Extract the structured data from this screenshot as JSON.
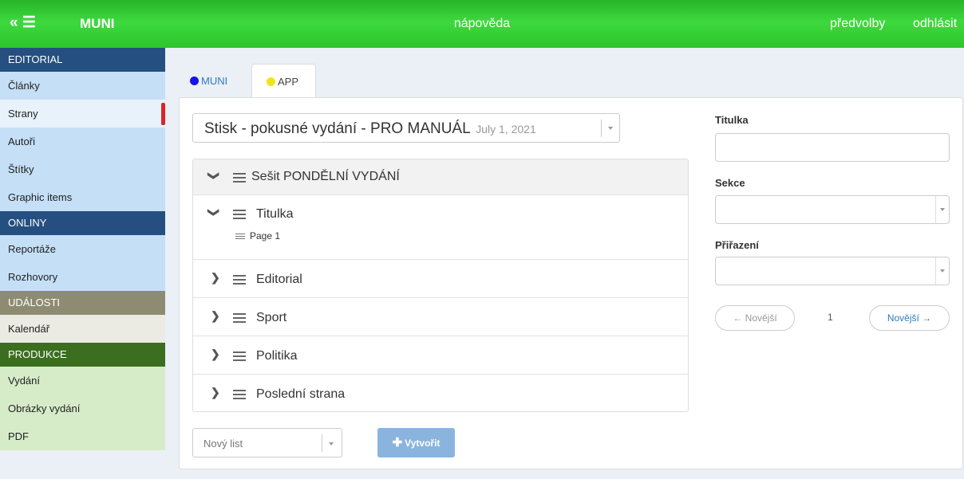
{
  "topbar": {
    "menu_toggle": "« ☰",
    "brand": "MUNI",
    "help": "nápověda",
    "preferences": "předvolby",
    "logout": "odhlásit"
  },
  "sidebar": {
    "sections": [
      {
        "title": "EDITORIAL",
        "items": [
          "Články",
          "Strany",
          "Autoři",
          "Štítky",
          "Graphic items"
        ]
      },
      {
        "title": "ONLINY",
        "items": [
          "Reportáže",
          "Rozhovory"
        ]
      },
      {
        "title": "UDÁLOSTI",
        "items": [
          "Kalendář"
        ]
      },
      {
        "title": "PRODUKCE",
        "items": [
          "Vydání",
          "Obrázky vydání",
          "PDF"
        ]
      }
    ],
    "active_item": "Strany"
  },
  "tabs": [
    {
      "label": "MUNI",
      "dot_color": "#1414e6",
      "active": false
    },
    {
      "label": "APP",
      "dot_color": "#f2e418",
      "active": true
    }
  ],
  "issue_select": {
    "name": "Stisk - pokusné vydání - PRO MANUÁL",
    "date": "July 1, 2021"
  },
  "tree": {
    "root": "Sešit PONDĚLNÍ VYDÁNÍ",
    "sections": [
      {
        "label": "Titulka",
        "expanded": true,
        "pages": [
          "Page 1"
        ]
      },
      {
        "label": "Editorial",
        "expanded": false
      },
      {
        "label": "Sport",
        "expanded": false
      },
      {
        "label": "Politika",
        "expanded": false
      },
      {
        "label": "Poslední strana",
        "expanded": false
      }
    ]
  },
  "new_list": {
    "placeholder": "Nový list"
  },
  "create_button": {
    "label": "Vytvořit"
  },
  "form": {
    "titulka_label": "Titulka",
    "titulka_value": "",
    "sekce_label": "Sekce",
    "sekce_value": "",
    "prirazeni_label": "Přiřazení",
    "prirazeni_value": ""
  },
  "pager": {
    "prev_label": "← Novější",
    "page": "1",
    "next_label": "Novější →"
  }
}
